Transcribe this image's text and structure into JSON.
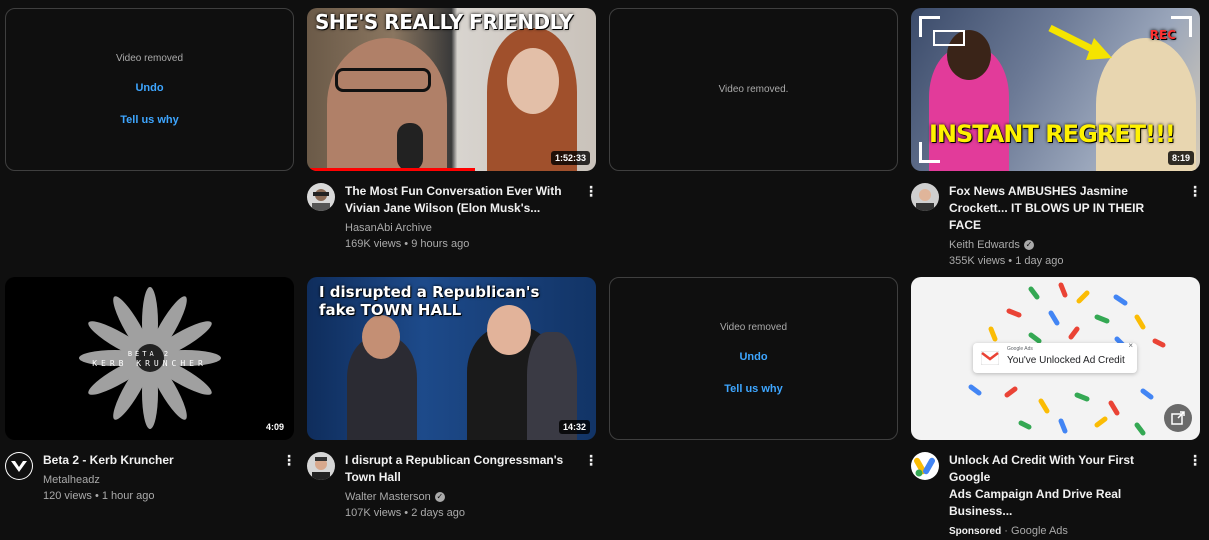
{
  "row1": {
    "removed_a": {
      "message": "Video removed",
      "undo": "Undo",
      "tell": "Tell us why"
    },
    "video_hasan": {
      "thumb_text": "SHE'S REALLY FRIENDLY",
      "duration": "1:52:33",
      "title_line1": "The Most Fun Conversation Ever With",
      "title_line2": "Vivian Jane Wilson (Elon Musk's...",
      "channel": "HasanAbi Archive",
      "stats": "169K views • 9 hours ago"
    },
    "removed_b": {
      "message": "Video removed."
    },
    "video_fox": {
      "thumb_text": "INSTANT REGRET!!!",
      "rec": "REC",
      "duration": "8:19",
      "title_line1": "Fox News AMBUSHES Jasmine",
      "title_line2": "Crockett... IT BLOWS UP IN THEIR FACE",
      "channel": "Keith Edwards",
      "stats": "355K views • 1 day ago"
    }
  },
  "row2": {
    "video_beta": {
      "thumb_line1": "BETA 2",
      "thumb_line2": "KERB KRUNCHER",
      "duration": "4:09",
      "title": "Beta 2 - Kerb Kruncher",
      "channel": "Metalheadz",
      "stats": "120 views • 1 hour ago"
    },
    "video_walter": {
      "thumb_line1": "I disrupted a Republican's",
      "thumb_line2": "fake TOWN HALL",
      "duration": "14:32",
      "title_line1": "I disrupt a Republican Congressman's",
      "title_line2": "Town Hall",
      "channel": "Walter Masterson",
      "stats": "107K views • 2 days ago"
    },
    "removed_c": {
      "message": "Video removed",
      "undo": "Undo",
      "tell": "Tell us why"
    },
    "ad": {
      "banner_small": "Google Ads",
      "banner_text": "You've Unlocked Ad Credit",
      "title_line1": "Unlock Ad Credit With Your First Google",
      "title_line2": "Ads Campaign And Drive Real Business...",
      "sponsored": "Sponsored",
      "advertiser": "Google Ads"
    }
  },
  "kebab": "⋮",
  "check": "✓"
}
